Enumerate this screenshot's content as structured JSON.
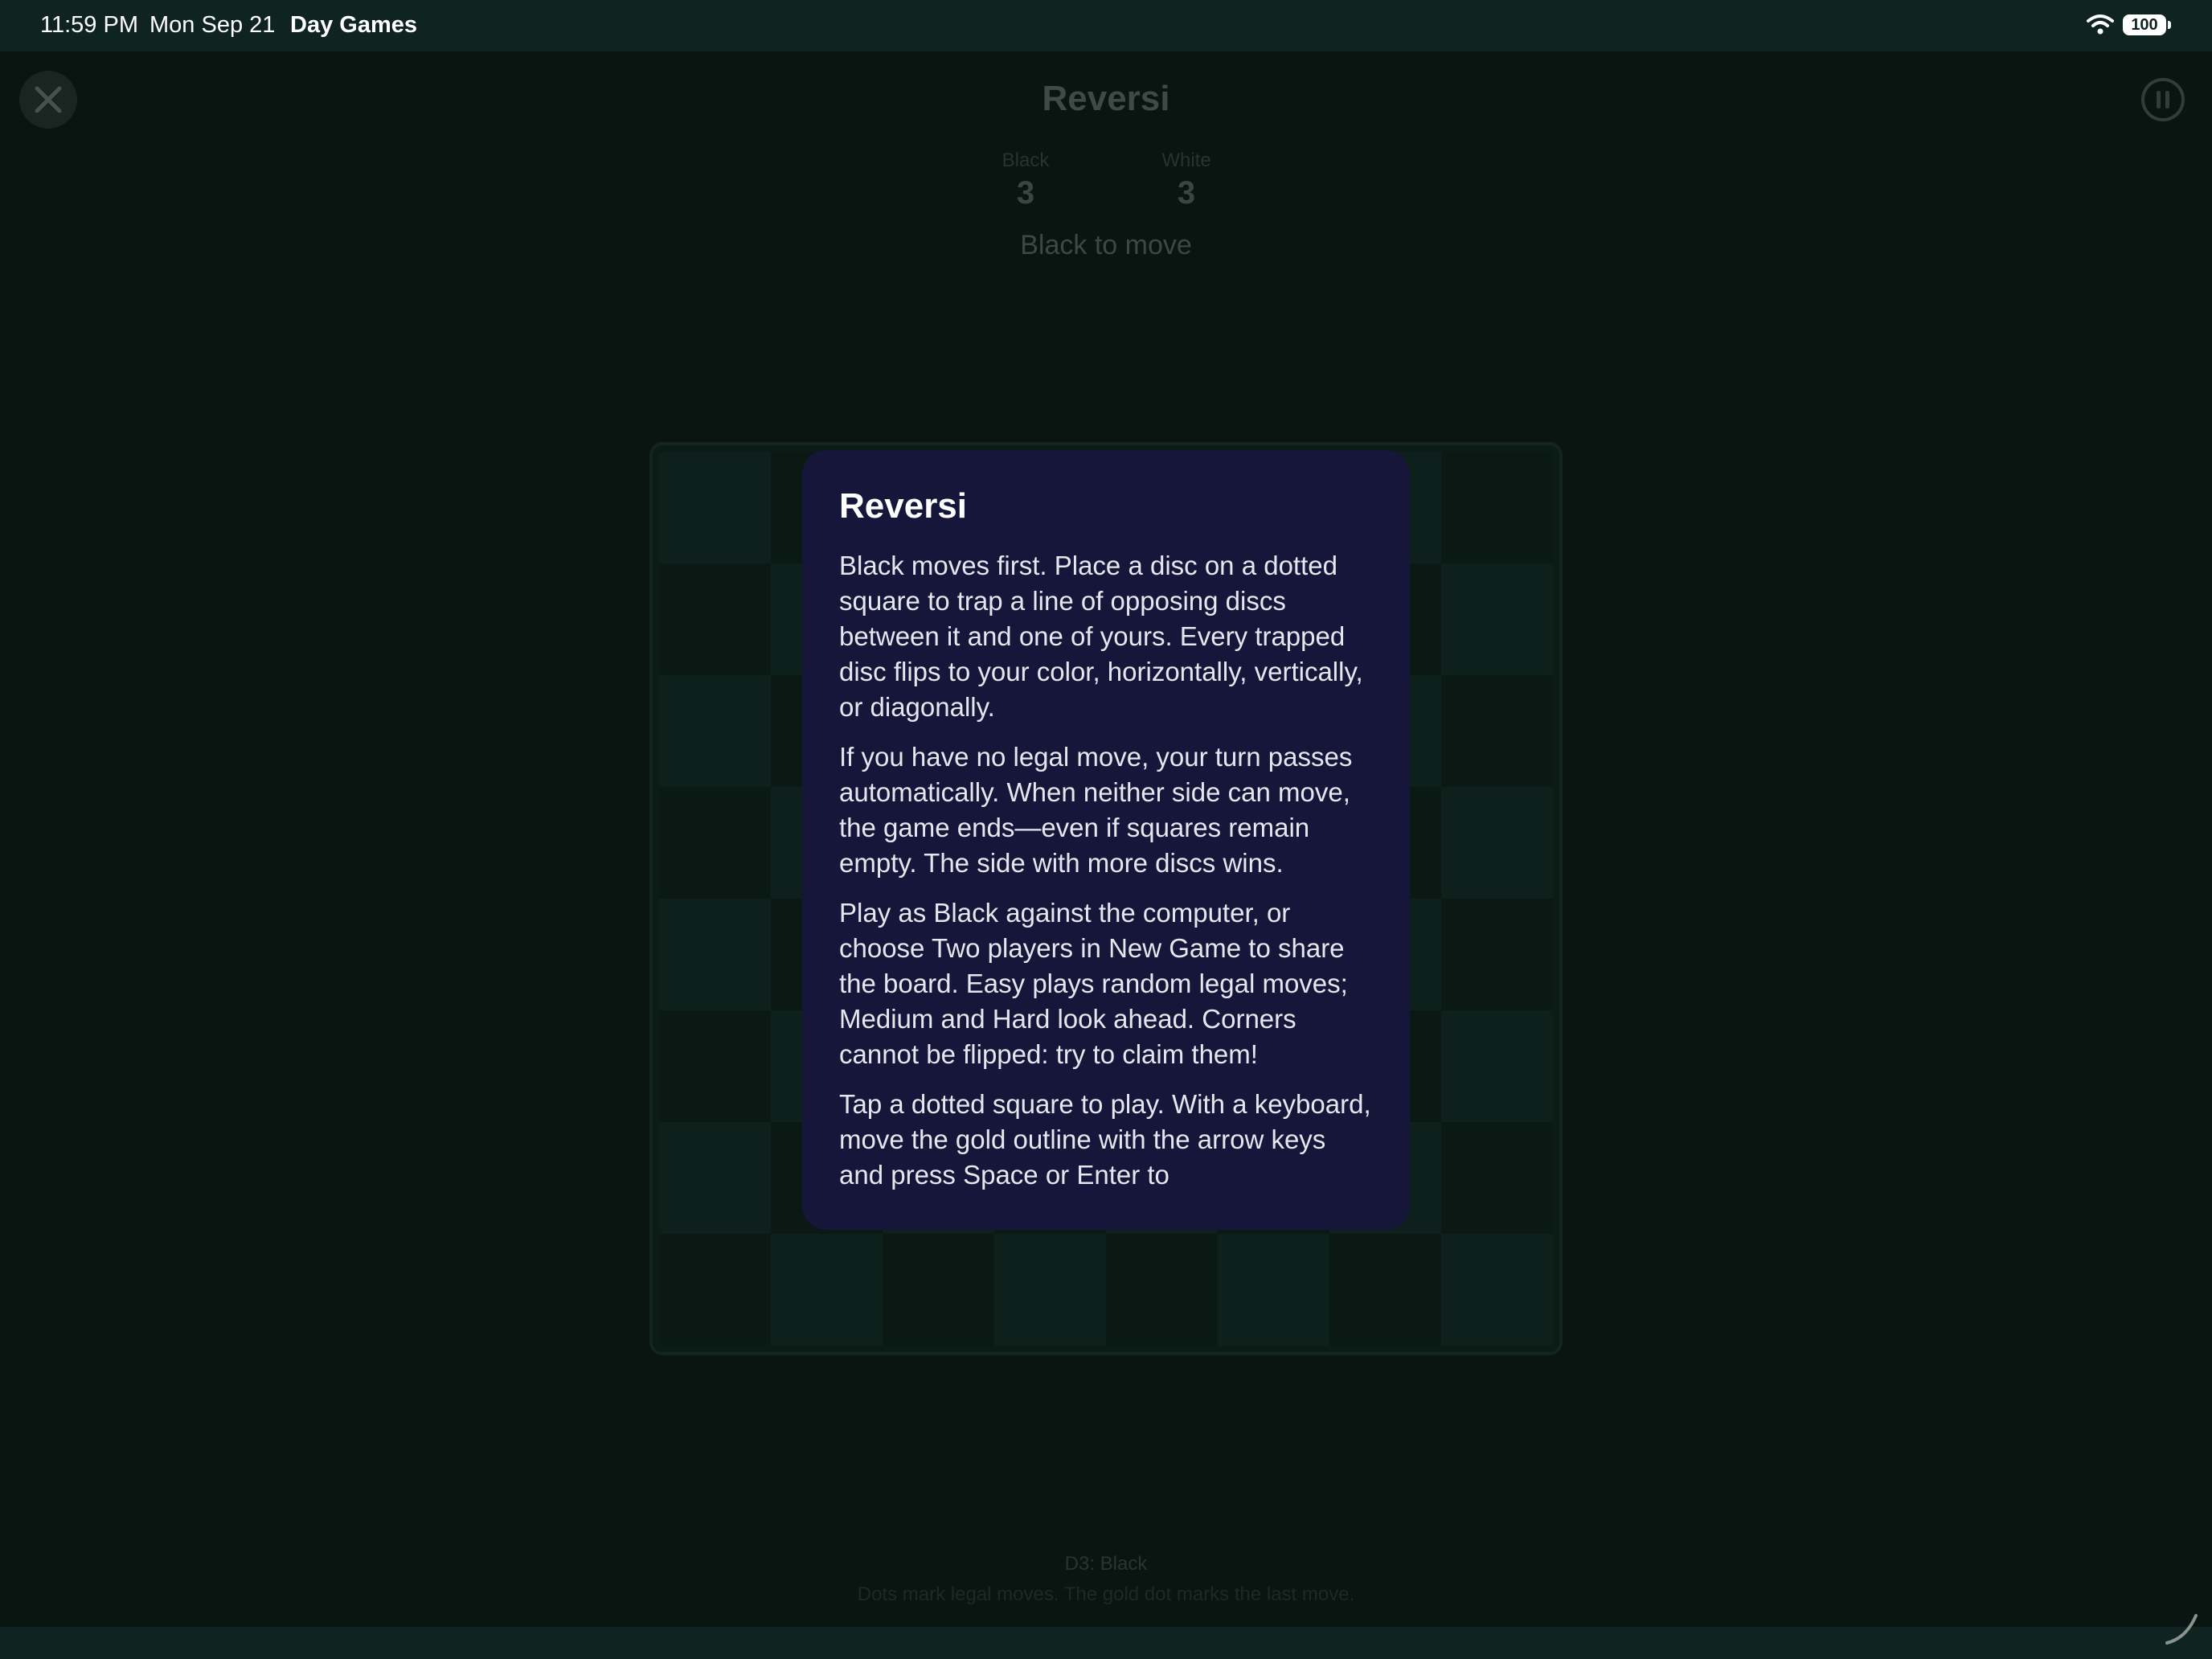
{
  "status_bar": {
    "time": "11:59 PM",
    "date": "Mon Sep 21",
    "app_name": "Day Games",
    "battery": "100",
    "wifi_icon": "wifi-icon"
  },
  "header": {
    "close_icon": "close-icon",
    "pause_icon": "pause-icon",
    "title": "Reversi"
  },
  "score": {
    "black_label": "Black",
    "black_value": "3",
    "white_label": "White",
    "white_value": "3"
  },
  "status": "Black to move",
  "board": {
    "rows": 8,
    "cols": 8
  },
  "footer": {
    "last_move": "D3: Black",
    "hint": "Dots mark legal moves. The gold dot marks the last move."
  },
  "modal": {
    "title": "Reversi",
    "paragraphs": [
      "Black moves first. Place a disc on a dotted square to trap a line of opposing discs between it and one of yours. Every trapped disc flips to your color, horizontally, vertically, or diagonally.",
      "If you have no legal move, your turn passes automatically. When neither side can move, the game ends—even if squares remain empty. The side with more discs wins.",
      "Play as Black against the computer, or choose Two players in New Game to share the board. Easy plays random legal moves; Medium and Hard look ahead. Corners cannot be flipped: try to claim them!",
      "Tap a dotted square to play. With a keyboard, move the gold outline with the arrow keys and press Space or Enter to"
    ]
  },
  "colors": {
    "background": "#0a1411",
    "status_bar": "#0f2420",
    "modal_background": "#16163a",
    "board": "#0b1c17"
  }
}
